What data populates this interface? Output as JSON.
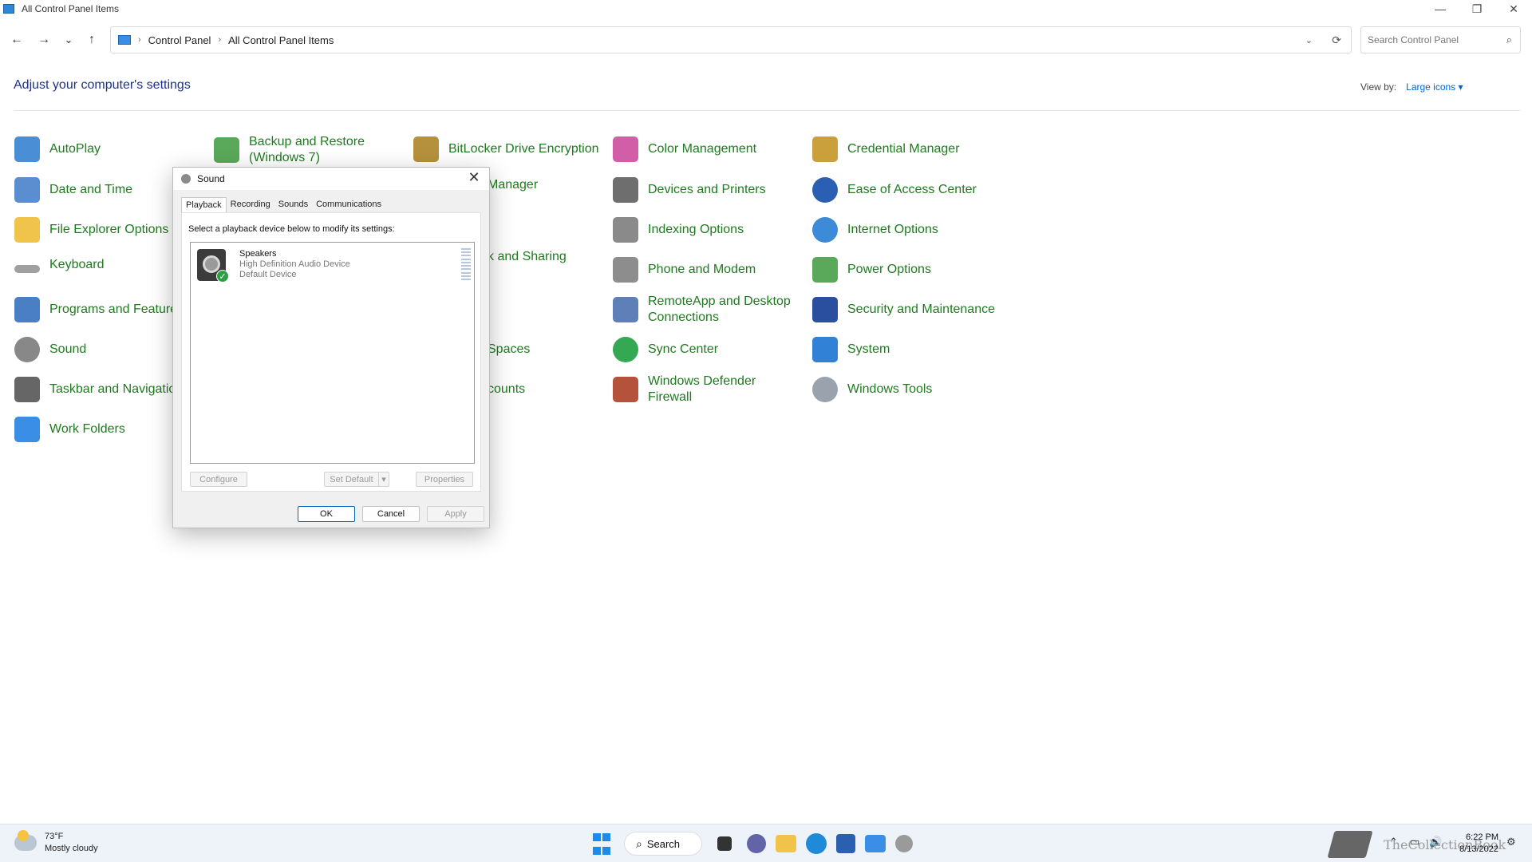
{
  "window": {
    "title": "All Control Panel Items",
    "minimize": "—",
    "restore": "❐",
    "close": "✕"
  },
  "nav": {
    "back": "←",
    "forward": "→",
    "recent": "⌄",
    "up": "↑",
    "breadcrumbs": [
      "Control Panel",
      "All Control Panel Items"
    ],
    "separator": "›",
    "address_dropdown": "⌄",
    "refresh": "⟳",
    "search_placeholder": "Search Control Panel",
    "search_icon": "⌕"
  },
  "content": {
    "heading": "Adjust your computer's settings",
    "view_by_label": "View by:",
    "view_by_value": "Large icons ▾"
  },
  "items": [
    {
      "label": "AutoPlay",
      "color": "#4a8fd6"
    },
    {
      "label": "Backup and Restore (Windows 7)",
      "color": "#5aa95a"
    },
    {
      "label": "BitLocker Drive Encryption",
      "color": "#b6913d"
    },
    {
      "label": "Color Management",
      "color": "#d35ea8"
    },
    {
      "label": "Credential Manager",
      "color": "#c9a03c"
    },
    {
      "label": "Date and Time",
      "color": "#5b8ed0"
    },
    {
      "label": "Manager",
      "color": "#ffffff"
    },
    {
      "label": "Devices and Printers",
      "color": "#6e6e6e"
    },
    {
      "label": "Ease of Access Center",
      "color": "#2a5fb4"
    },
    {
      "label": "File Explorer Options",
      "color": "#f0c34a"
    },
    {
      "label": "Indexing Options",
      "color": "#8a8a8a"
    },
    {
      "label": "Internet Options",
      "color": "#3c8ad8"
    },
    {
      "label": "Keyboard",
      "color": "#a0a0a0"
    },
    {
      "label": "k and Sharing",
      "color": "#ffffff"
    },
    {
      "label": "Phone and Modem",
      "color": "#8d8d8d"
    },
    {
      "label": "Power Options",
      "color": "#5aa95a"
    },
    {
      "label": "Programs and Feature",
      "color": "#4a7fc6"
    },
    {
      "label": "RemoteApp and Desktop Connections",
      "color": "#5f7fb8"
    },
    {
      "label": "Security and Maintenance",
      "color": "#2a4f9e"
    },
    {
      "label": "Sound",
      "color": "#888888"
    },
    {
      "label": "Spaces",
      "color": "#ffffff"
    },
    {
      "label": "Sync Center",
      "color": "#34a853"
    },
    {
      "label": "System",
      "color": "#3182d6"
    },
    {
      "label": "Taskbar and Navigatio",
      "color": "#666666"
    },
    {
      "label": "counts",
      "color": "#ffffff"
    },
    {
      "label": "Windows Defender Firewall",
      "color": "#b5523b"
    },
    {
      "label": "Windows Tools",
      "color": "#9aa3ad"
    },
    {
      "label": "Work Folders",
      "color": "#3a8ee6"
    }
  ],
  "dialog": {
    "title": "Sound",
    "close": "✕",
    "tabs": [
      "Playback",
      "Recording",
      "Sounds",
      "Communications"
    ],
    "instruction": "Select a playback device below to modify its settings:",
    "device": {
      "name": "Speakers",
      "driver": "High Definition Audio Device",
      "status": "Default Device",
      "check": "✓"
    },
    "buttons": {
      "configure": "Configure",
      "set_default": "Set Default",
      "set_default_arrow": "▾",
      "properties": "Properties",
      "ok": "OK",
      "cancel": "Cancel",
      "apply": "Apply"
    }
  },
  "taskbar": {
    "weather_temp": "73°F",
    "weather_desc": "Mostly cloudy",
    "search_label": "Search",
    "search_icon": "⌕",
    "brand": "TheCollectionBook",
    "time": "6:22 PM",
    "date": "8/13/2022",
    "tray_up": "⌃",
    "tray_net": "▭",
    "tray_vol": "🔊",
    "tray_notif": "⚙"
  }
}
